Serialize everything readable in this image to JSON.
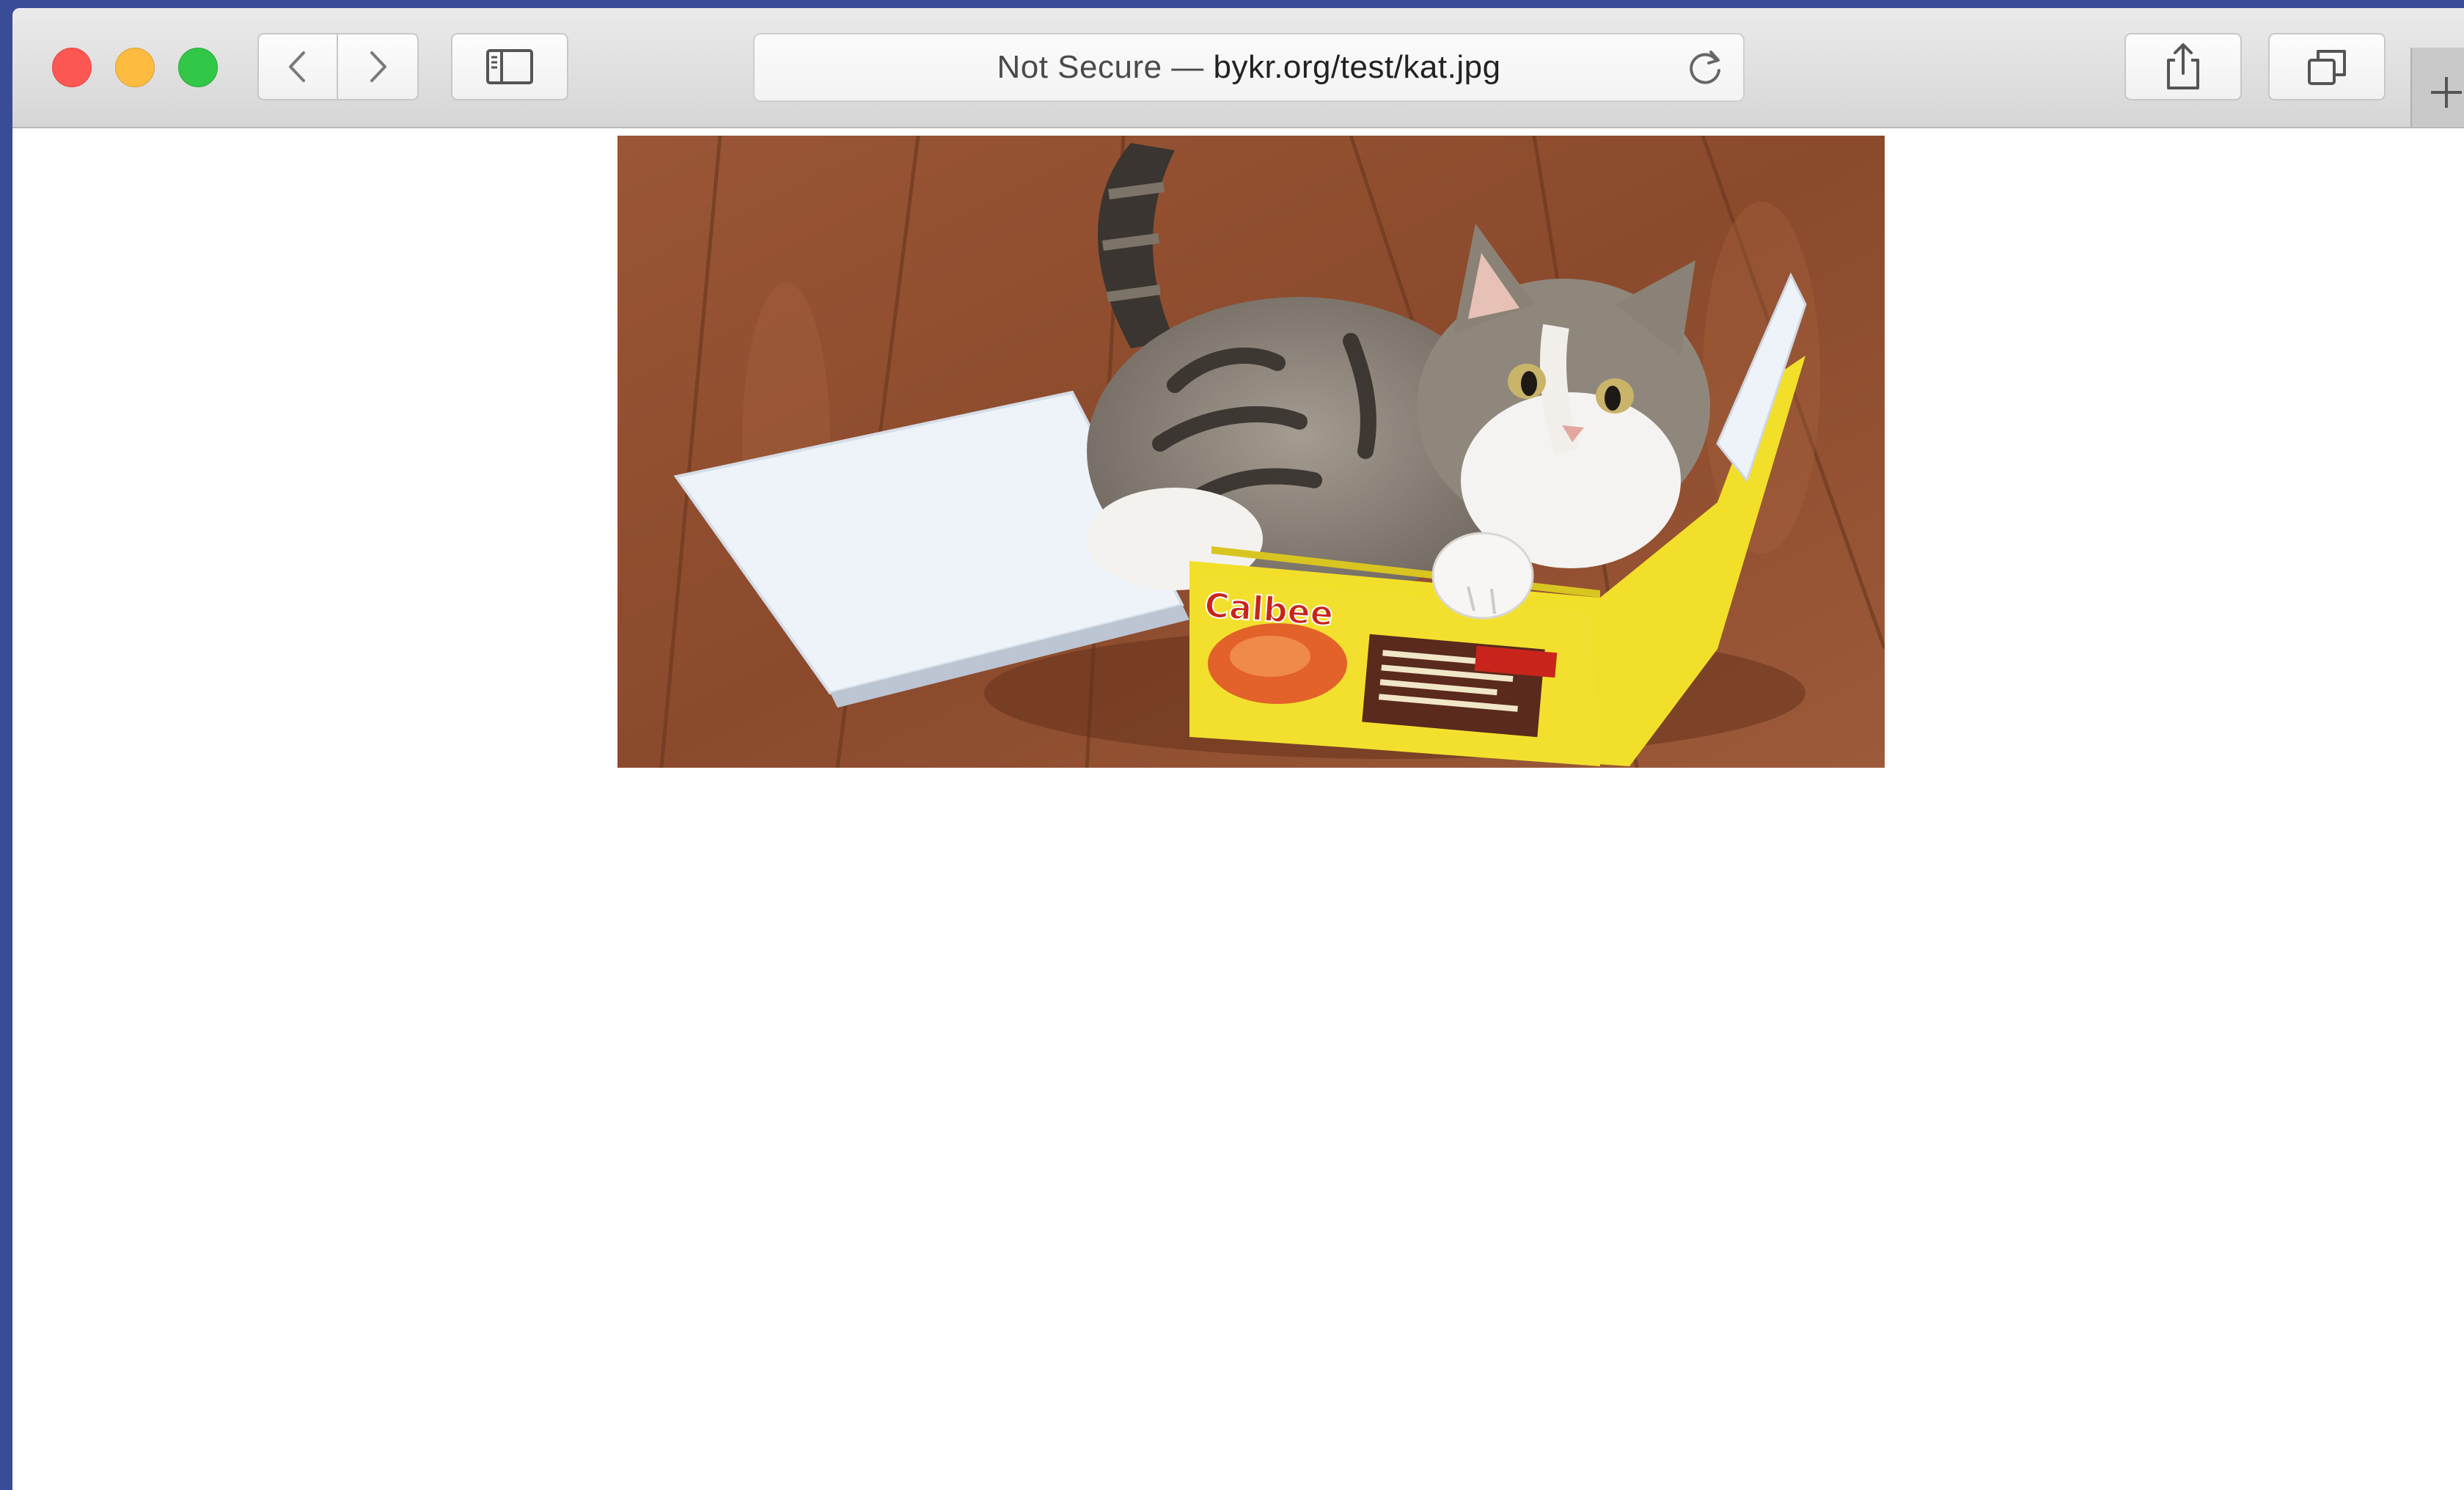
{
  "browser": {
    "address_prefix": "Not Secure — ",
    "address_host": "bykr.org/test/kat.jpg",
    "toolbar_icons": [
      "back-icon",
      "forward-icon",
      "sidebar-icon",
      "reload-icon",
      "share-icon",
      "tabs-overview-icon",
      "plus-icon"
    ]
  },
  "page": {
    "image_subject": "cat sitting in a yellow cardboard box on a wooden floor",
    "image_box_text": "Calbee"
  },
  "colors": {
    "close": "#fc5753",
    "minimize": "#fdbc40",
    "maximize": "#33c748",
    "desktop": "#3a4b98"
  }
}
